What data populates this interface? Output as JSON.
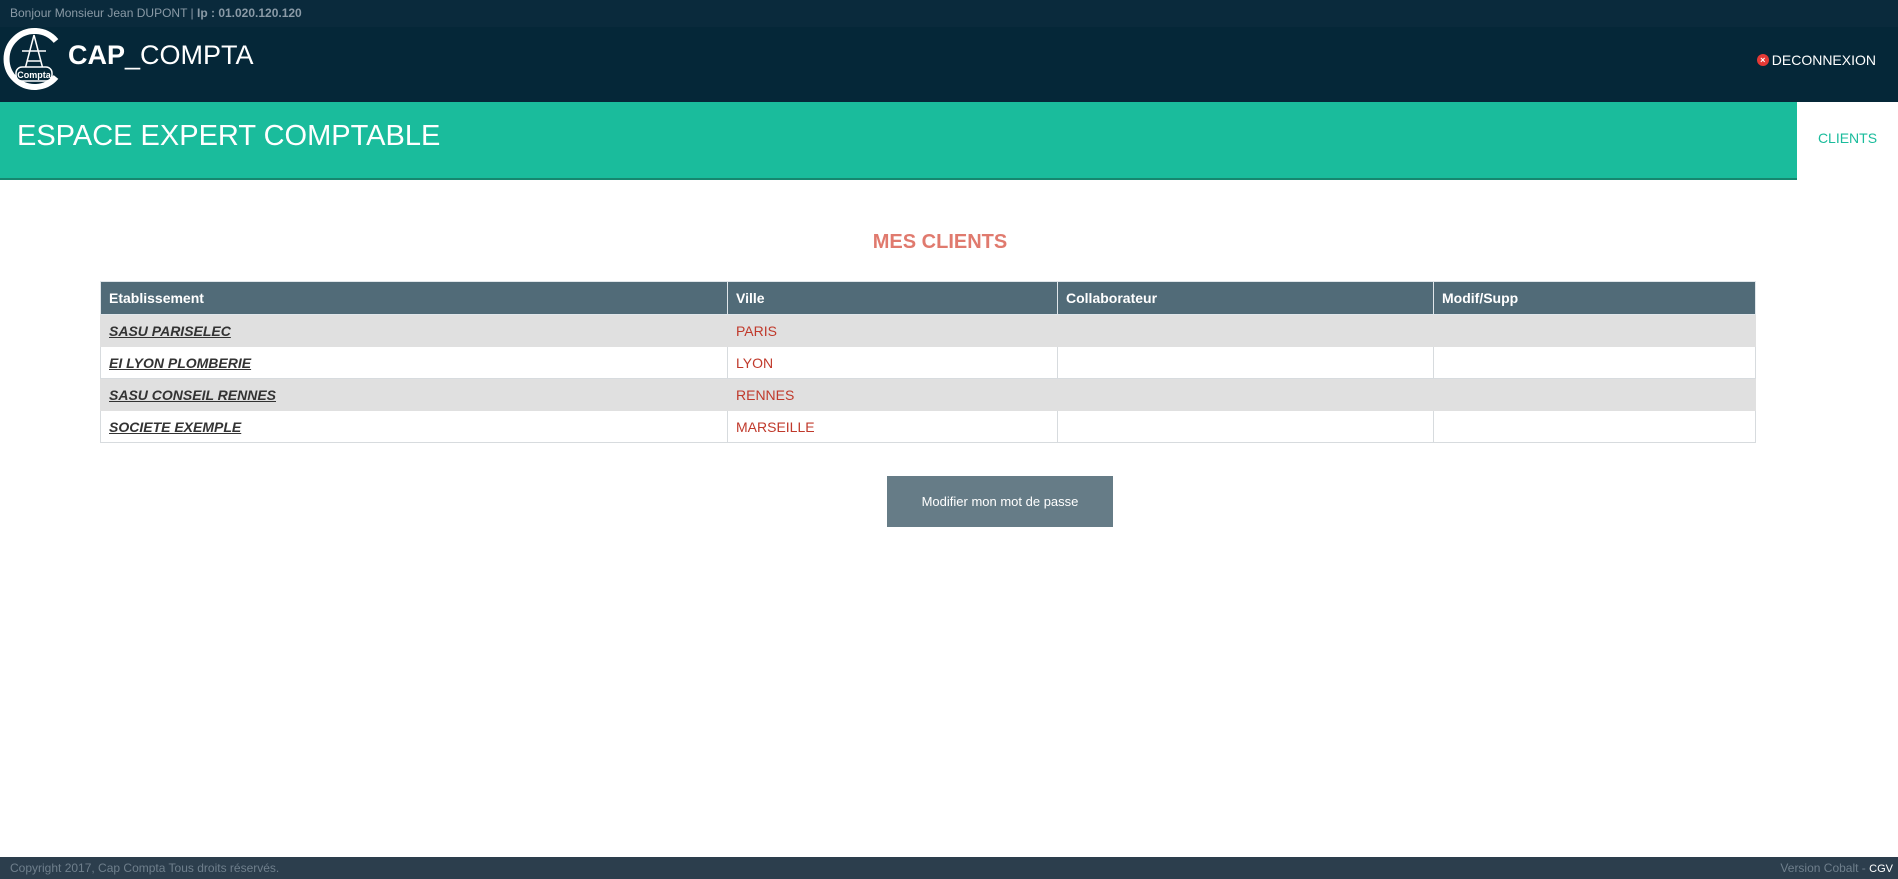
{
  "topbar": {
    "greeting": "Bonjour Monsieur Jean DUPONT |",
    "ip_label": "Ip : 01.020.120.120"
  },
  "header": {
    "brand_bold": "CAP",
    "brand_rest": "_COMPTA",
    "logo_text": "Compta",
    "logout_label": "DECONNEXION"
  },
  "band": {
    "title": "ESPACE EXPERT COMPTABLE",
    "tab_clients": "CLIENTS"
  },
  "main": {
    "section_title": "MES CLIENTS",
    "columns": [
      "Etablissement",
      "Ville",
      "Collaborateur",
      "Modif/Supp"
    ],
    "rows": [
      {
        "etablissement": "SASU PARISELEC",
        "ville": "PARIS",
        "collaborateur": "",
        "modif": ""
      },
      {
        "etablissement": "EI LYON PLOMBERIE",
        "ville": "LYON",
        "collaborateur": "",
        "modif": ""
      },
      {
        "etablissement": "SASU CONSEIL RENNES",
        "ville": "RENNES",
        "collaborateur": "",
        "modif": ""
      },
      {
        "etablissement": "SOCIETE EXEMPLE",
        "ville": "MARSEILLE",
        "collaborateur": "",
        "modif": ""
      }
    ],
    "change_password_label": "Modifier mon mot de passe"
  },
  "footer": {
    "copyright": "Copyright 2017, Cap Compta Tous droits réservés.",
    "version": "Version Cobalt -",
    "cgv": "CGV"
  },
  "colors": {
    "accent": "#1abc9c",
    "header_bg": "#052738",
    "title_red": "#e07a6e",
    "table_head": "#516b78"
  }
}
